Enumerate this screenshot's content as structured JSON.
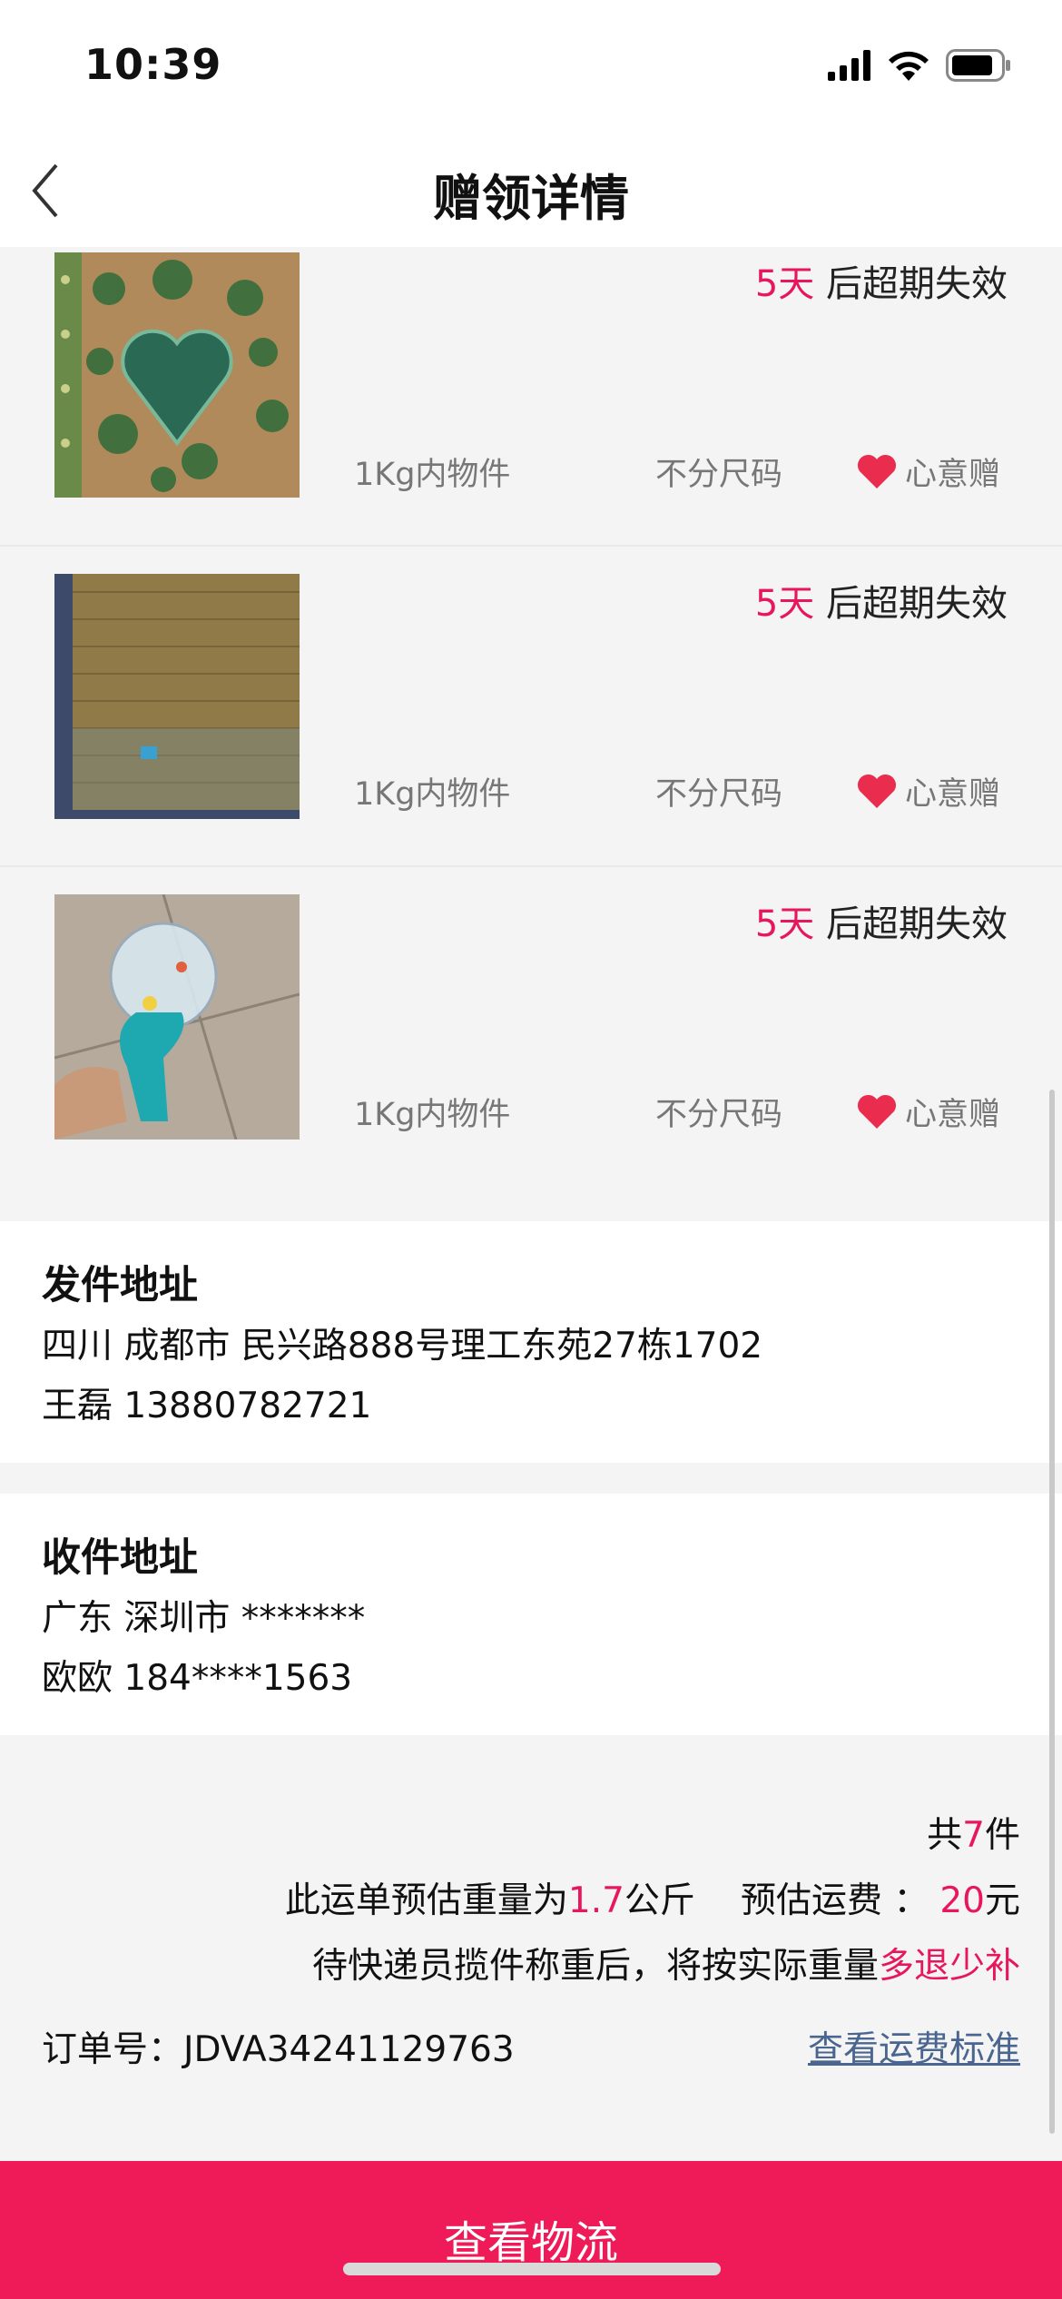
{
  "status_bar": {
    "time": "10:39"
  },
  "nav": {
    "title": "赠领详情"
  },
  "items": [
    {
      "expire_days": "5天",
      "expire_suffix": " 后超期失效",
      "weight": "1Kg内物件",
      "size": "不分尺码",
      "tag": "心意赠",
      "image": "green-floral-notebook-photo"
    },
    {
      "expire_days": "5天",
      "expire_suffix": " 后超期失效",
      "weight": "1Kg内物件",
      "size": "不分尺码",
      "tag": "心意赠",
      "image": "woven-straw-mat-photo"
    },
    {
      "expire_days": "5天",
      "expire_suffix": " 后超期失效",
      "weight": "1Kg内物件",
      "size": "不分尺码",
      "tag": "心意赠",
      "image": "toy-bubble-gun-photo"
    }
  ],
  "sender": {
    "title": "发件地址",
    "address": "四川 成都市 民兴路888号理工东苑27栋1702",
    "contact": "王磊 13880782721"
  },
  "receiver": {
    "title": "收件地址",
    "address": "广东 深圳市 *******",
    "contact": "欧欧 184****1563"
  },
  "summary": {
    "count_prefix": "共",
    "count": "7",
    "count_suffix": "件",
    "weight_prefix": "此运单预估重量为",
    "weight": "1.7",
    "weight_suffix": "公斤",
    "fee_prefix": "预估运费 ：",
    "fee": "20",
    "fee_suffix": "元",
    "note_prefix": "待快递员揽件称重后，将按实际重量",
    "note_highlight": "多退少补",
    "order_label": "订单号：",
    "order_number": "JDVA34241129763",
    "freight_link": "查看运费标准"
  },
  "bottom_button": {
    "label": "查看物流"
  },
  "colors": {
    "accent": "#e8175d",
    "button": "#ef1a58",
    "link": "#4a6590"
  }
}
